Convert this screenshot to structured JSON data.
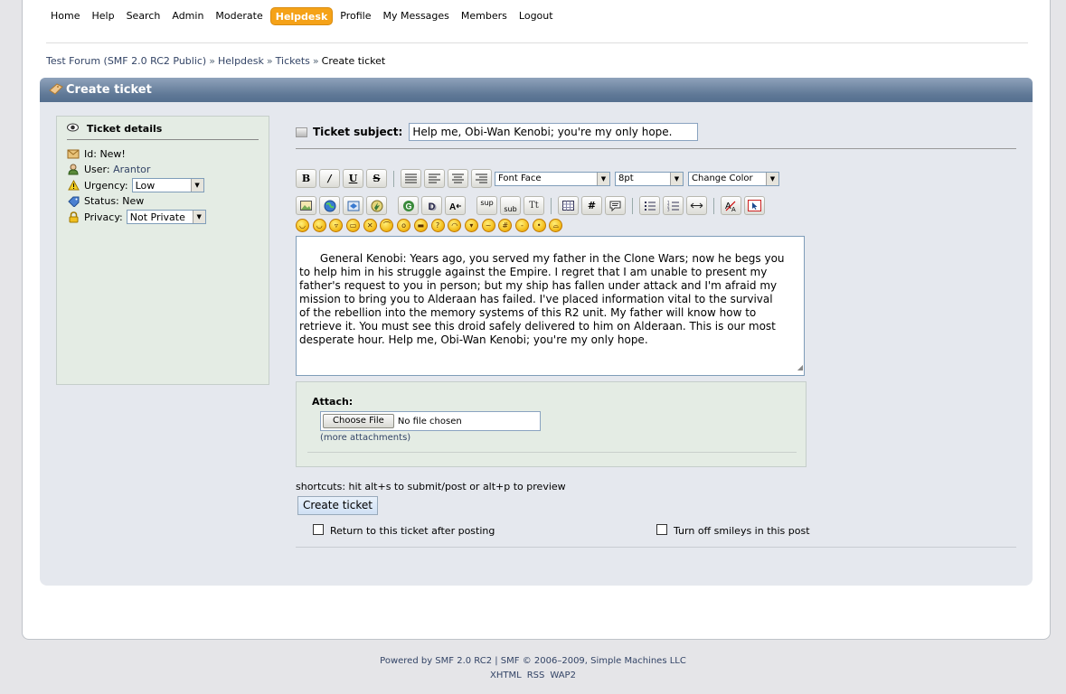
{
  "menu": {
    "items": [
      {
        "label": "Home"
      },
      {
        "label": "Help"
      },
      {
        "label": "Search"
      },
      {
        "label": "Admin"
      },
      {
        "label": "Moderate"
      },
      {
        "label": "Helpdesk",
        "active": true
      },
      {
        "label": "Profile"
      },
      {
        "label": "My Messages"
      },
      {
        "label": "Members"
      },
      {
        "label": "Logout"
      }
    ]
  },
  "breadcrumb": {
    "items": [
      "Test Forum (SMF 2.0 RC2 Public)",
      "Helpdesk",
      "Tickets"
    ],
    "current": "Create ticket",
    "separator": "»"
  },
  "page": {
    "title": "Create ticket"
  },
  "details": {
    "heading": "Ticket details",
    "id_label": "Id:",
    "id_value": "New!",
    "user_label": "User:",
    "user_value": "Arantor",
    "urgency_label": "Urgency:",
    "urgency_value": "Low",
    "status_label": "Status:",
    "status_value": "New",
    "privacy_label": "Privacy:",
    "privacy_value": "Not Private"
  },
  "subject": {
    "label": "Ticket subject:",
    "value": "Help me, Obi-Wan Kenobi; you're my only hope."
  },
  "editor": {
    "font_face": "Font Face",
    "font_size": "8pt",
    "color": "Change Color",
    "message": "General Kenobi: Years ago, you served my father in the Clone Wars; now he begs you\nto help him in his struggle against the Empire. I regret that I am unable to present my\nfather's request to you in person; but my ship has fallen under attack and I'm afraid my\nmission to bring you to Alderaan has failed. I've placed information vital to the survival\nof the rebellion into the memory systems of this R2 unit. My father will know how to\nretrieve it. You must see this droid safely delivered to him on Alderaan. This is our most\ndesperate hour. Help me, Obi-Wan Kenobi; you're my only hope."
  },
  "attach": {
    "label": "Attach:",
    "button": "Choose File",
    "status": "No file chosen",
    "more": "(more attachments)"
  },
  "shortcuts": "shortcuts: hit alt+s to submit/post or alt+p to preview",
  "submit_label": "Create ticket",
  "options": {
    "return_label": "Return to this ticket after posting",
    "smileys_label": "Turn off smileys in this post"
  },
  "footer": {
    "powered": "Powered by SMF 2.0 RC2 | SMF © 2006–2009, Simple Machines LLC",
    "links": [
      "XHTML",
      "RSS",
      "WAP2"
    ]
  },
  "colors": {
    "accent": "#f5a218",
    "header_bar": "#5f7896",
    "panel_bg": "#e5e8ee",
    "link": "#334466"
  }
}
